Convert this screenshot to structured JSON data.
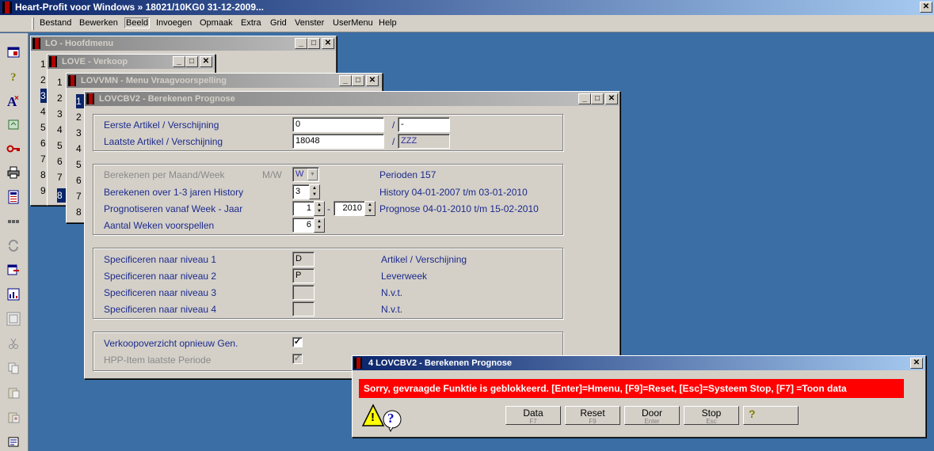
{
  "app": {
    "title": "Heart-Profit voor Windows  »  18021/10KG0   31-12-2009..."
  },
  "menu": [
    "Bestand",
    "Bewerken",
    "Beeld",
    "Invoegen",
    "Opmaak",
    "Extra",
    "Grid",
    "Venster",
    "UserMenu",
    "Help"
  ],
  "toolbar_icons": [
    "exit-icon",
    "help-icon",
    "font-icon",
    "import-icon",
    "key-icon",
    "print-icon",
    "calculator-icon",
    "grid-icon",
    "refresh-icon",
    "export-icon",
    "chart-icon",
    "window-icon",
    "cut-icon",
    "copy-icon",
    "paste-icon",
    "paste-special-icon",
    "properties-icon"
  ],
  "windows": {
    "lo": {
      "title": "LO - Hoofdmenu",
      "rows": [
        "1",
        "2",
        "3",
        "4",
        "5",
        "6",
        "7",
        "8",
        "9"
      ]
    },
    "love": {
      "title": "LOVE - Verkoop",
      "rows": [
        "1",
        "2",
        "3",
        "4",
        "5",
        "6",
        "7",
        "8"
      ]
    },
    "lovvmn": {
      "title": "LOVVMN - Menu Vraagvoorspelling",
      "rows": [
        "1",
        "2",
        "3",
        "4",
        "5",
        "6",
        "7",
        "8"
      ]
    },
    "lovcbv2": {
      "title": "LOVCBV2 - Berekenen Prognose"
    }
  },
  "form": {
    "eerste_label": "Eerste Artikel / Verschijning",
    "eerste_value": "0",
    "eerste_versch": "-",
    "laatste_label": "Laatste Artikel / Verschijning",
    "laatste_value": "18048",
    "laatste_versch": "ZZZ",
    "slash": "/",
    "maand_week_label": "Berekenen per Maand/Week",
    "mw": "M/W",
    "mw_value": "W",
    "perioden": "Perioden 157",
    "jaren_label": "Berekenen over 1-3 jaren History",
    "jaren_value": "3",
    "history": "History  04-01-2007 t/m 03-01-2010",
    "vanaf_label": "Prognotiseren vanaf Week - Jaar",
    "week_value": "1",
    "dash": "-",
    "jaar_value": "2010",
    "prognose": "Prognose 04-01-2010 t/m 15-02-2010",
    "weken_label": "Aantal Weken voorspellen",
    "weken_value": "6",
    "niveau1_label": "Specificeren naar niveau 1",
    "niveau1_value": "D",
    "niveau1_desc": "Artikel / Verschijning",
    "niveau2_label": "Specificeren naar niveau 2",
    "niveau2_value": "P",
    "niveau2_desc": "Leverweek",
    "niveau3_label": "Specificeren naar niveau 3",
    "niveau3_value": "",
    "niveau3_desc": "N.v.t.",
    "niveau4_label": "Specificeren naar niveau 4",
    "niveau4_value": "",
    "niveau4_desc": "N.v.t.",
    "verkoop_label": "Verkoopoverzicht opnieuw Gen.",
    "verkoop_checked": true,
    "hpp_label": "HPP-Item laatste Periode",
    "hpp_checked": true,
    "check_glyph": "✓"
  },
  "dialog": {
    "title": "4 LOVCBV2 - Berekenen Prognose",
    "message": "Sorry, gevraagde Funktie is geblokkeerd.  [Enter]=Hmenu, [F9]=Reset, [Esc]=Systeem Stop, [F7] =Toon data",
    "buttons": [
      {
        "label": "Data",
        "key": "F7"
      },
      {
        "label": "Reset",
        "key": "F9"
      },
      {
        "label": "Door",
        "key": "Enter"
      },
      {
        "label": "Stop",
        "key": "Esc"
      }
    ],
    "help_glyph": "?",
    "warning_glyph": "!",
    "question_glyph": "?",
    "close_glyph": "✕"
  },
  "window_controls": {
    "min": "_",
    "max": "□",
    "close": "✕"
  },
  "colors": {
    "desktop": "#3a6ea5",
    "title_active": "#0a246a",
    "error": "#ff0000",
    "label_blue": "#1c2a8c"
  }
}
